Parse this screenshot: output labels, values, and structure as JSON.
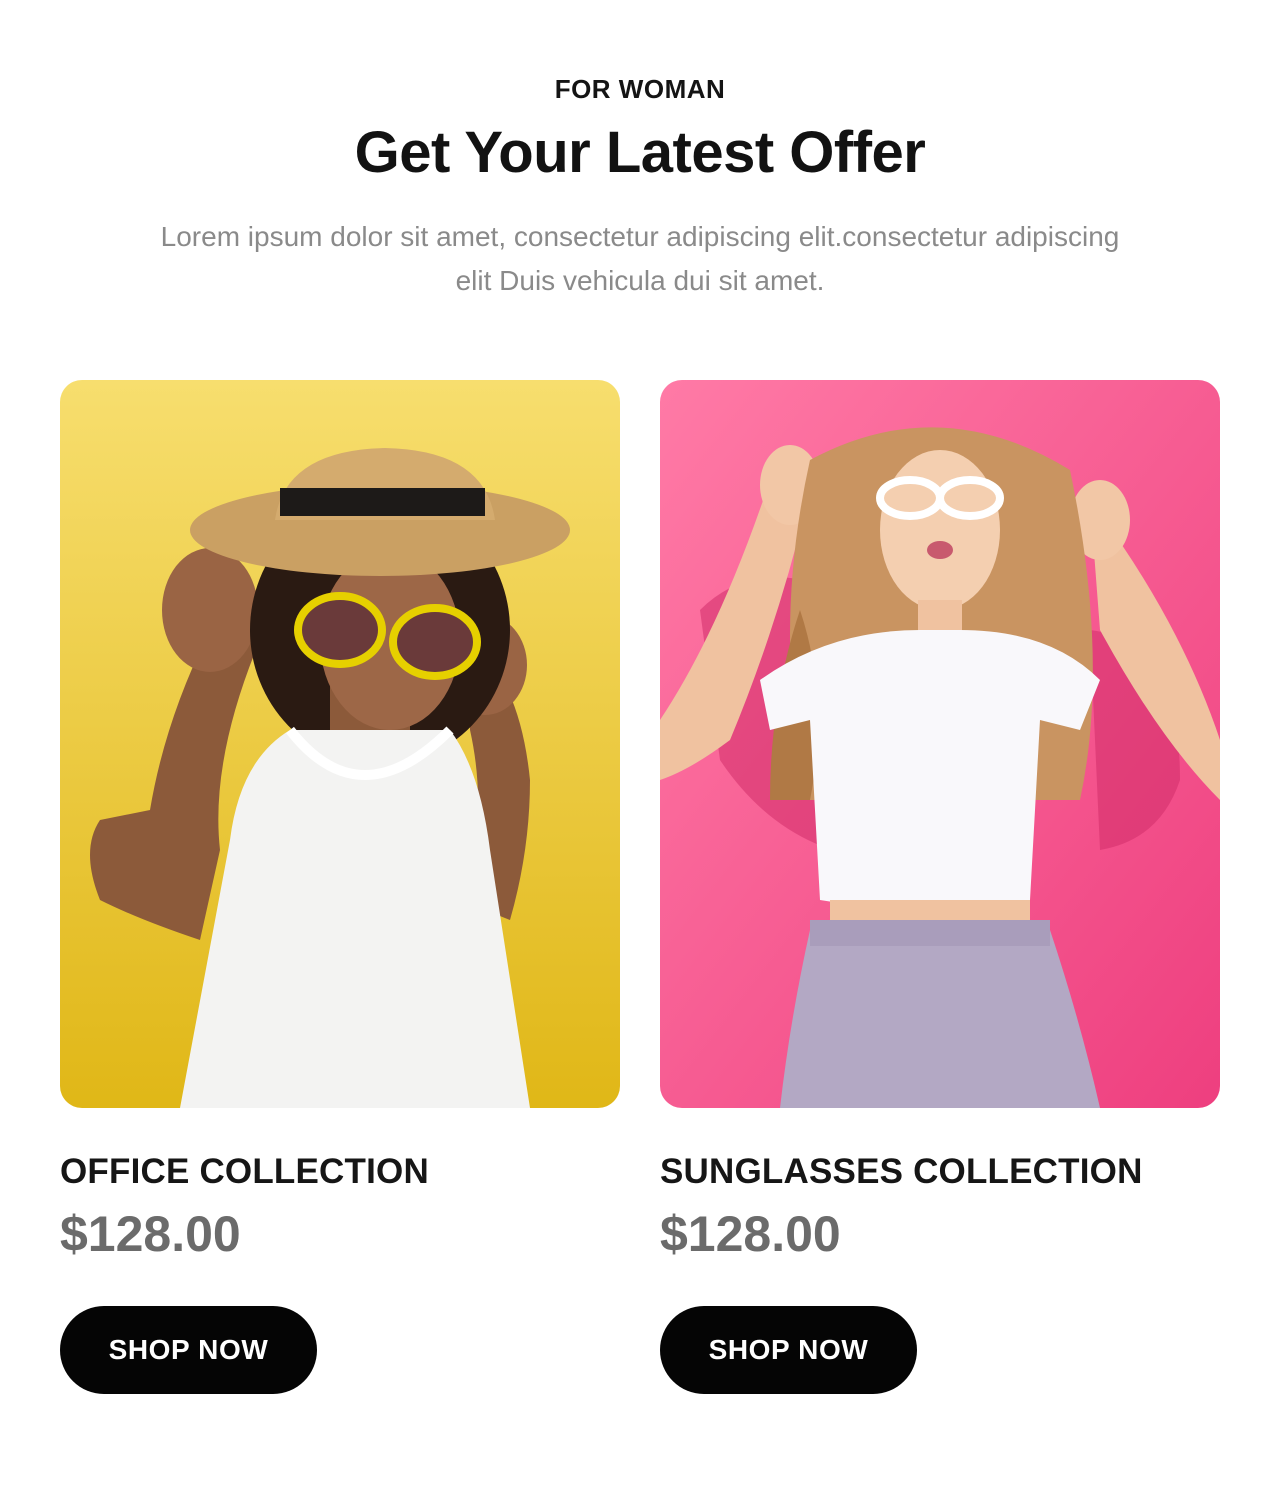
{
  "header": {
    "eyebrow": "FOR WOMAN",
    "title": "Get Your Latest Offer",
    "description": "Lorem ipsum dolor sit amet, consectetur adipiscing elit.consectetur adipiscing elit Duis vehicula dui sit amet."
  },
  "cards": [
    {
      "title": "OFFICE COLLECTION",
      "price": "$128.00",
      "button_label": "SHOP NOW",
      "background_color": "#f2cf48"
    },
    {
      "title": "SUNGLASSES COLLECTION",
      "price": "$128.00",
      "button_label": "SHOP NOW",
      "background_color": "#f2528c"
    }
  ],
  "colors": {
    "button": "#050505",
    "price": "#6b6b6b",
    "description": "#8a8a8a"
  }
}
